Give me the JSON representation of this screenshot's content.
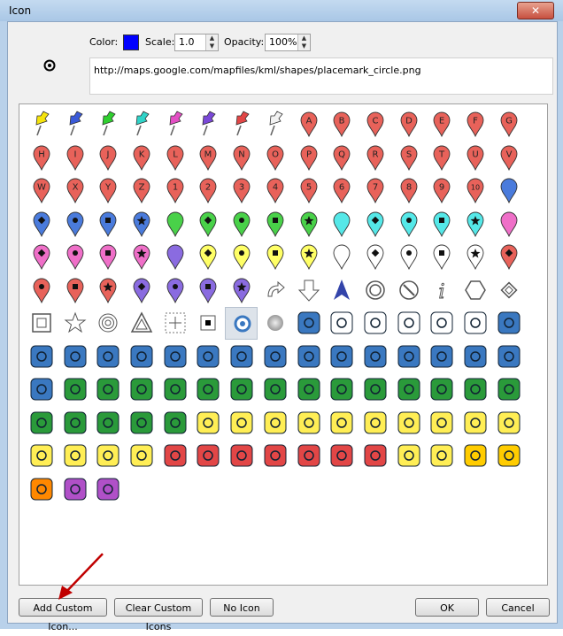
{
  "window": {
    "title": "Icon",
    "close_glyph": "✕"
  },
  "toolbar": {
    "color_label": "Color:",
    "color_value": "#0000ff",
    "scale_label": "Scale:",
    "scale_value": "1.0",
    "opacity_label": "Opacity:",
    "opacity_value": "100%"
  },
  "url": "http://maps.google.com/mapfiles/kml/shapes/placemark_circle.png",
  "icons": {
    "pushpins": [
      "yellow",
      "blue",
      "green",
      "teal",
      "pink",
      "purple",
      "red",
      "white"
    ],
    "pushpin_colors": {
      "yellow": "#f5e30c",
      "blue": "#3a5ad8",
      "green": "#2fcf2f",
      "teal": "#2fd3c8",
      "pink": "#e34fc4",
      "purple": "#7a48d8",
      "red": "#e24646",
      "white": "#f2f2f2"
    },
    "letters_row1": [
      "A",
      "B",
      "C",
      "D",
      "E",
      "F",
      "G"
    ],
    "letters_row2": [
      "H",
      "I",
      "J",
      "K",
      "L",
      "M",
      "N",
      "O",
      "P",
      "Q",
      "R",
      "S",
      "T",
      "U",
      "V"
    ],
    "letters_row3": [
      "W",
      "X",
      "Y",
      "Z",
      "1",
      "2",
      "3",
      "4",
      "5",
      "6",
      "7",
      "8",
      "9",
      "10"
    ],
    "selected_name": "placemark-circle"
  },
  "buttons": {
    "add_custom": "Add Custom Icon...",
    "clear_custom": "Clear Custom Icons",
    "no_icon": "No Icon",
    "ok": "OK",
    "cancel": "Cancel"
  }
}
